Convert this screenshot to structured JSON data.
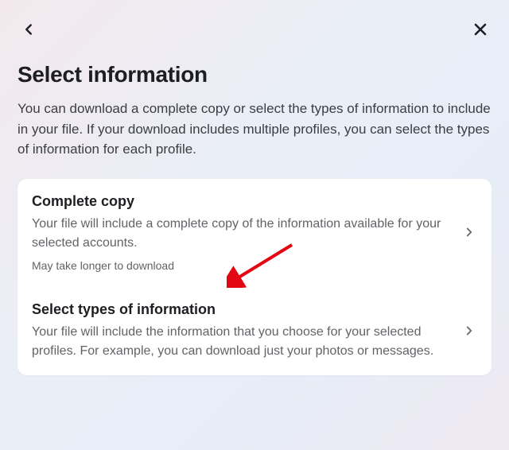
{
  "page": {
    "title": "Select information",
    "subtitle": "You can download a complete copy or select the types of information to include in your file. If your download includes multiple profiles, you can select the types of information for each profile."
  },
  "options": {
    "complete": {
      "title": "Complete copy",
      "desc": "Your file will include a complete copy of the information available for your selected accounts.",
      "note": "May take longer to download"
    },
    "select": {
      "title": "Select types of information",
      "desc": "Your file will include the information that you choose for your selected profiles. For example, you can download just your photos or messages."
    }
  }
}
